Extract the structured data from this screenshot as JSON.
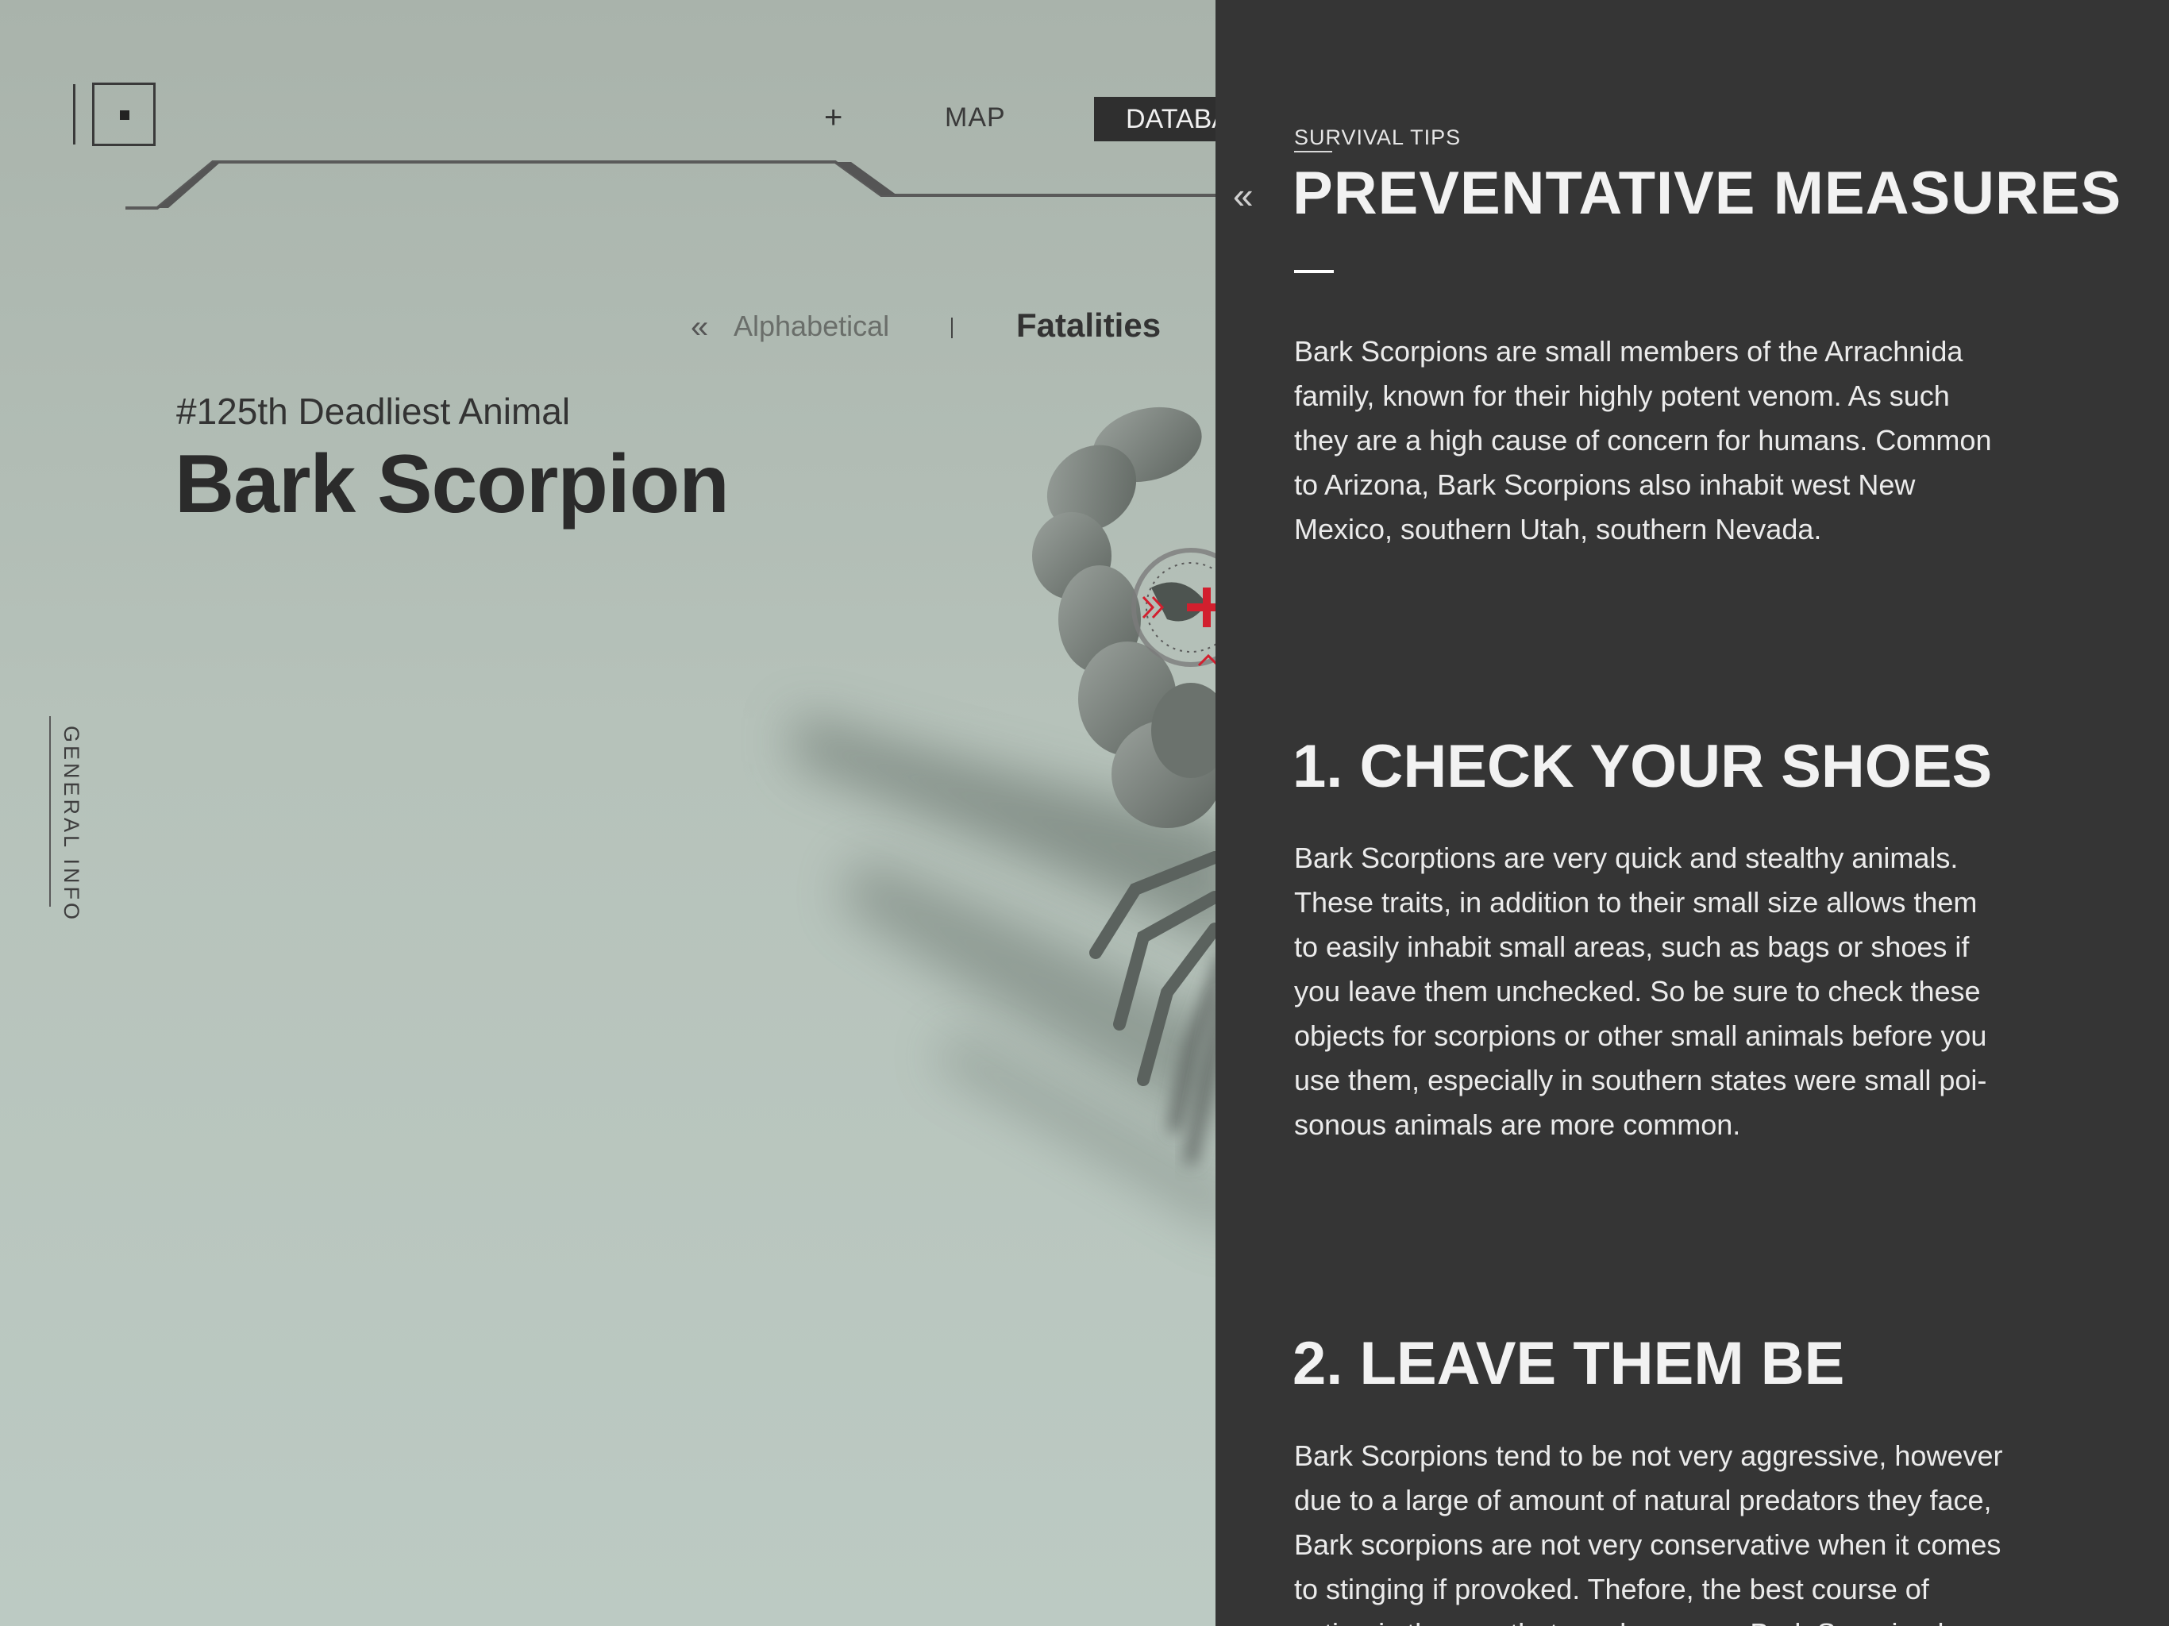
{
  "nav": {
    "add_symbol": "+",
    "map_label": "MAP",
    "database_label": "DATABA"
  },
  "sort": {
    "alphabetical_label": "Alphabetical",
    "fatalities_label": "Fatalities",
    "back_symbol": "«"
  },
  "animal": {
    "rank_text": "#125th Deadliest Animal",
    "name": "Bark Scorpion"
  },
  "side_tab": {
    "label": "GENERAL INFO"
  },
  "panel": {
    "back_symbol": "«",
    "eyebrow": "SURVIVAL TIPS",
    "title": "PREVENTATIVE MEASURES",
    "intro": "Bark Scorpions are  small members of the Arrachnida family, known for their highly potent venom. As such they are a high cause of concern for humans. Common to Arizona, Bark Scorpions also inhabit west New Mexico, southern Utah, southern Nevada.",
    "sections": [
      {
        "heading": "1. CHECK YOUR SHOES",
        "body": "Bark Scorptions are very quick and stealthy animals. These traits, in addition to their small size allows them to easily inhabit small areas, such as bags or shoes if you leave them unchecked. So be sure to check these objects for scorpions or other small animals before you use them, especially in southern states were small poi-sonous animals are more common."
      },
      {
        "heading": "2. LEAVE THEM BE",
        "body": "Bark Scorpions tend to be not very aggressive, however due to a large of amount of natural predators they face, Bark scorpions are not very conservative when it comes to stinging if provoked. Thefore, the best course of action is the one that you leave any Bark Scorpion be."
      }
    ]
  },
  "colors": {
    "panel_background": "#353535",
    "target_accent": "#d21f2e",
    "nav_active_background": "#2f2f2f"
  }
}
